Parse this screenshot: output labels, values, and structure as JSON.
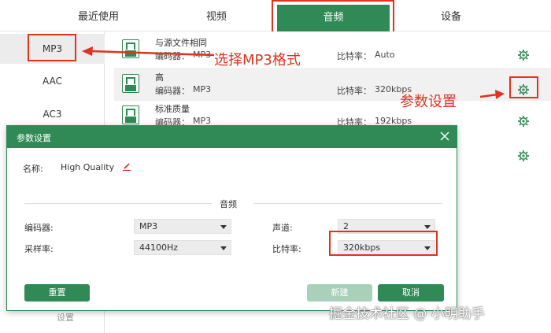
{
  "tabs": [
    {
      "label": "最近使用"
    },
    {
      "label": "视频"
    },
    {
      "label": "音频"
    },
    {
      "label": "设备"
    }
  ],
  "formats": [
    {
      "label": "MP3"
    },
    {
      "label": "AAC"
    },
    {
      "label": "AC3"
    }
  ],
  "formats_bottom": "设置",
  "presets": [
    {
      "title": "与源文件相同",
      "encoder_label": "编码器：",
      "encoder": "MP3",
      "bitrate_label": "比特率：",
      "bitrate": "Auto"
    },
    {
      "title": "高",
      "encoder_label": "编码器：",
      "encoder": "MP3",
      "bitrate_label": "比特率：",
      "bitrate": "320kbps"
    },
    {
      "title": "标准质量",
      "encoder_label": "编码器：",
      "encoder": "MP3",
      "bitrate_label": "比特率：",
      "bitrate": "192kbps"
    },
    {
      "title": "",
      "encoder_label": "",
      "encoder": "",
      "bitrate_label": "",
      "bitrate": ""
    }
  ],
  "annotations": {
    "select_mp3": "选择MP3格式",
    "param_settings": "参数设置"
  },
  "dialog": {
    "title": "参数设置",
    "name_label": "名称:",
    "name_value": "High Quality",
    "section_title": "音频",
    "encoder_label": "编码器:",
    "encoder_value": "MP3",
    "samplerate_label": "采样率:",
    "samplerate_value": "44100Hz",
    "channel_label": "声道:",
    "channel_value": "2",
    "bitrate_label": "比特率:",
    "bitrate_value": "320kbps",
    "reset_label": "重置",
    "new_label": "新建",
    "cancel_label": "取消"
  },
  "watermark": "掘金技术社区 @ 小明助手",
  "colors": {
    "accent": "#2f8a55",
    "annotation": "#e0321e",
    "disabled_button": "#a9d0b8"
  },
  "icons": [
    "music-file-icon",
    "gear-icon",
    "close-icon",
    "edit-pencil-icon",
    "chevron-down-icon"
  ]
}
